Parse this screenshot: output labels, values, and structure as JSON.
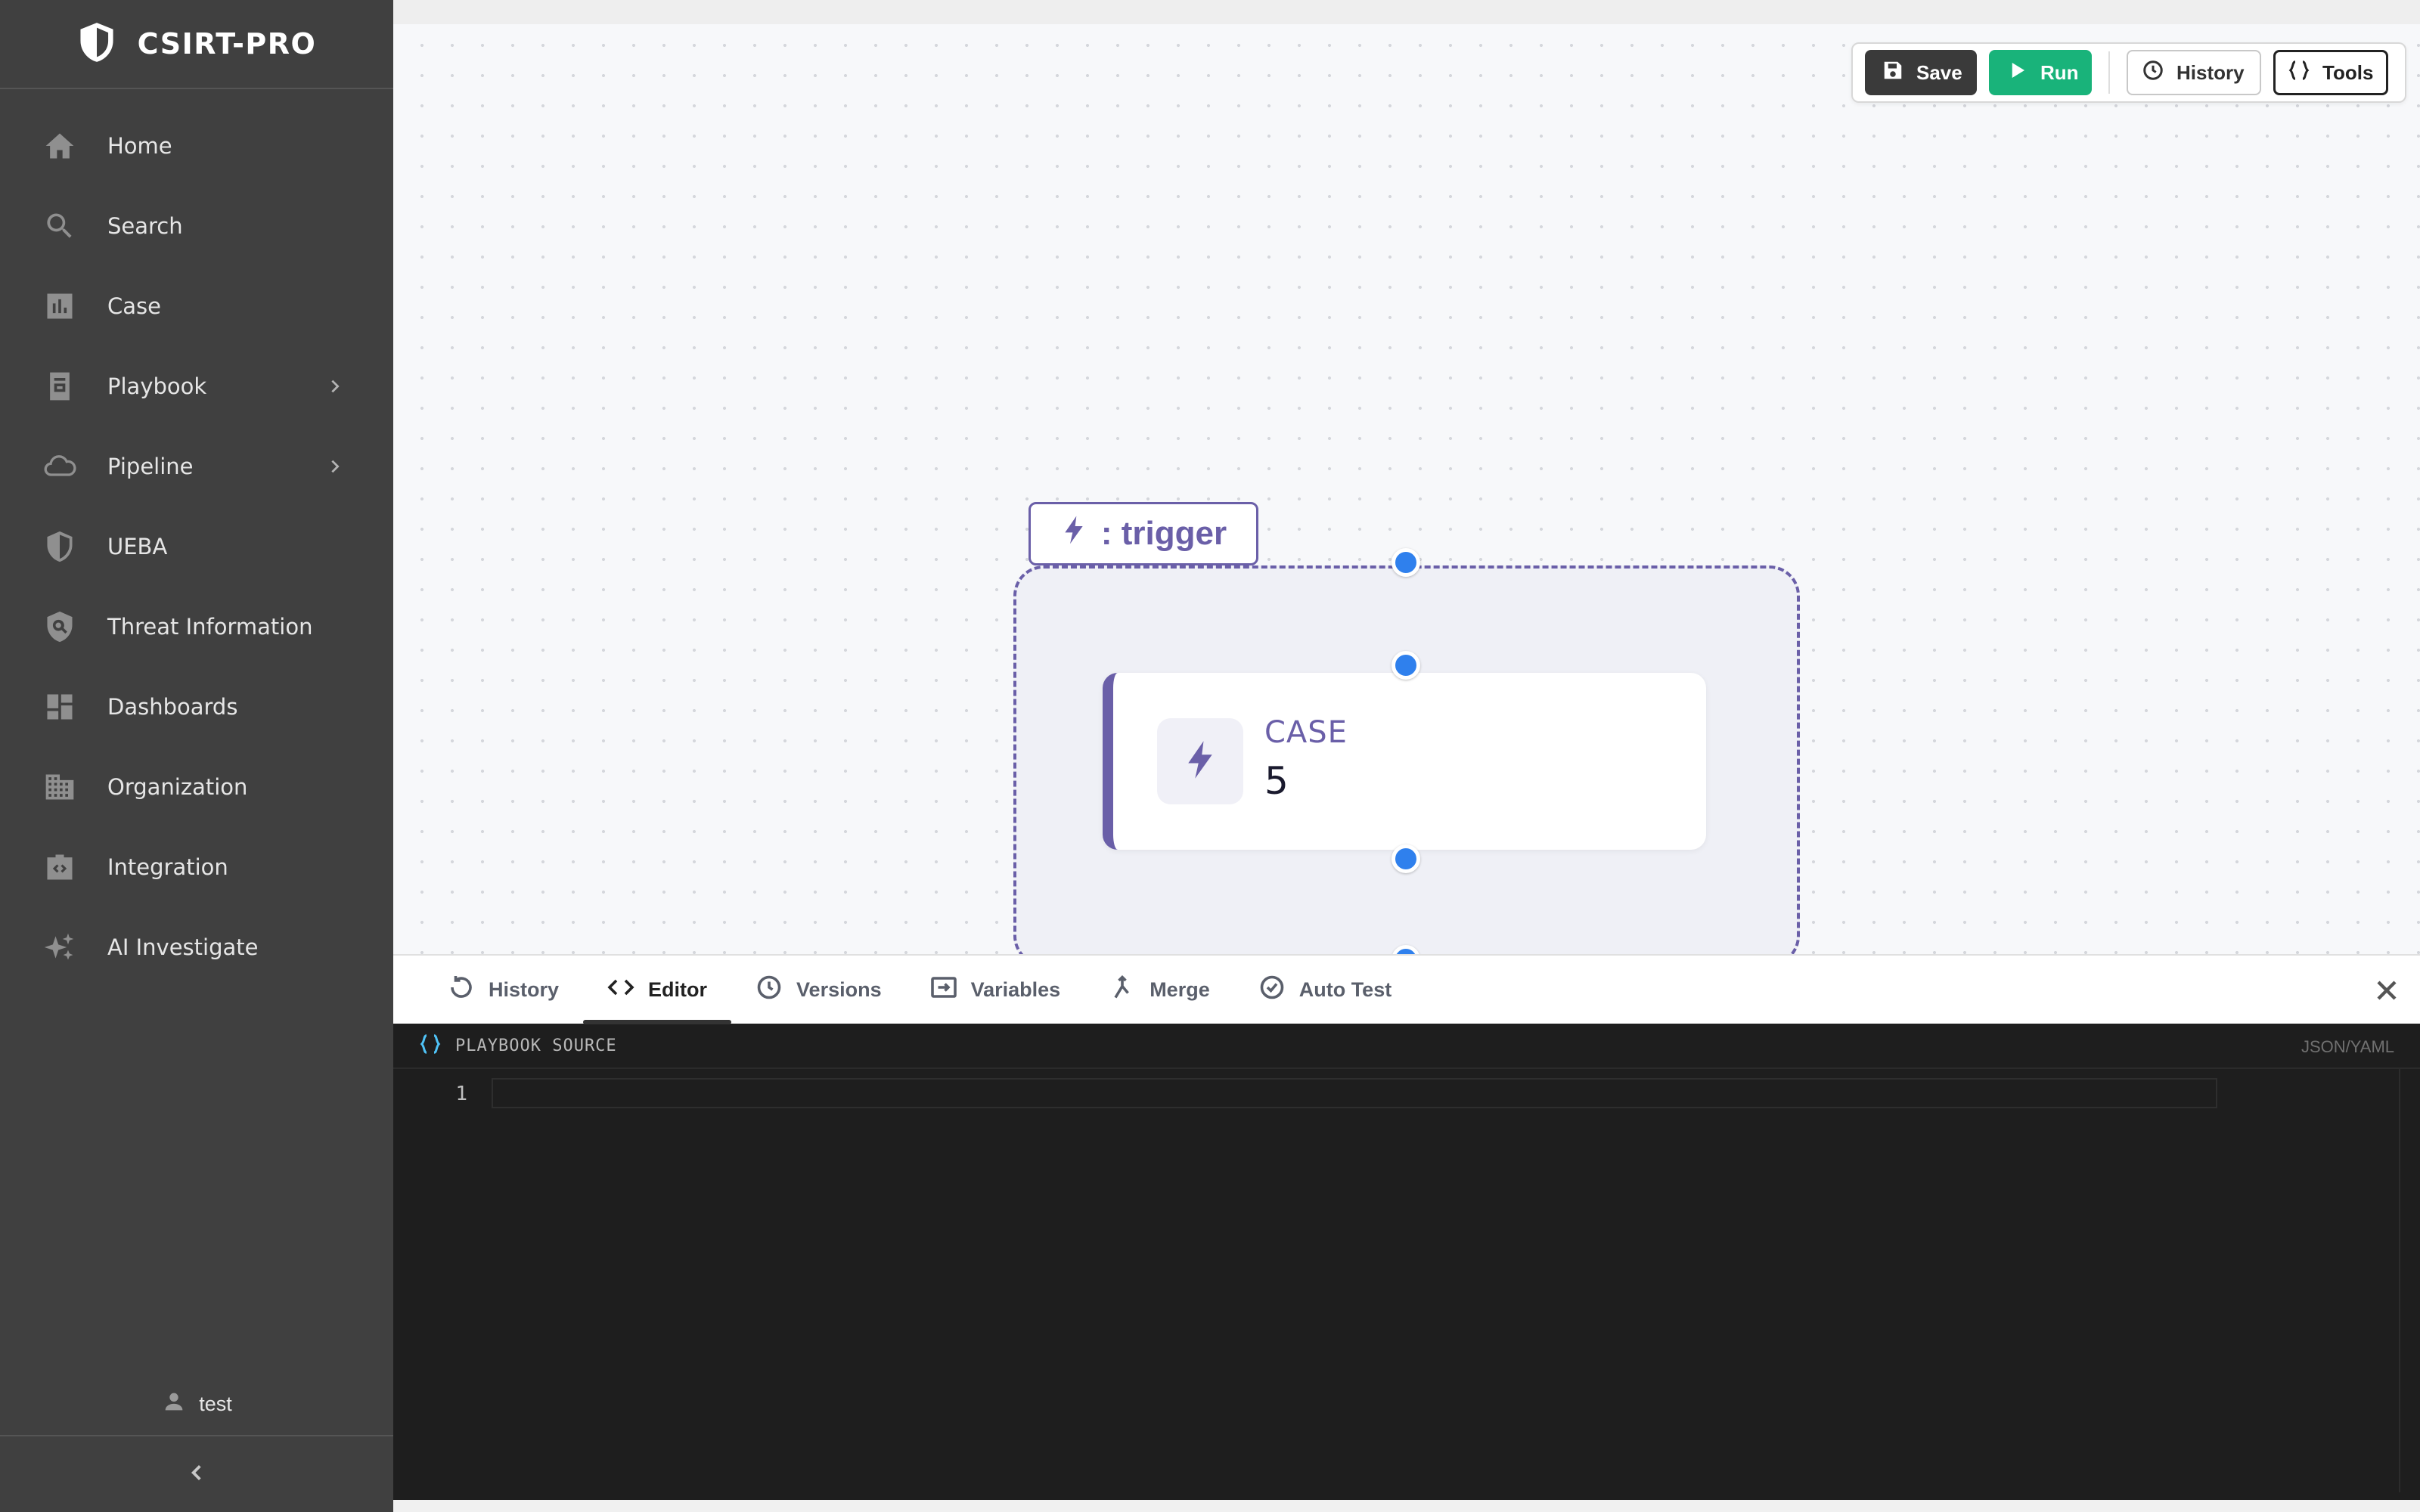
{
  "brand": {
    "title": "CSIRT-PRO"
  },
  "sidebar": {
    "items": [
      {
        "label": "Home",
        "icon": "home-icon"
      },
      {
        "label": "Search",
        "icon": "search-icon"
      },
      {
        "label": "Case",
        "icon": "bar-chart-icon"
      },
      {
        "label": "Playbook",
        "icon": "book-icon",
        "expandable": true
      },
      {
        "label": "Pipeline",
        "icon": "cloud-icon",
        "expandable": true
      },
      {
        "label": "UEBA",
        "icon": "shield-icon"
      },
      {
        "label": "Threat Information",
        "icon": "shield-search-icon"
      },
      {
        "label": "Dashboards",
        "icon": "dashboard-icon"
      },
      {
        "label": "Organization",
        "icon": "building-icon"
      },
      {
        "label": "Integration",
        "icon": "integration-icon"
      },
      {
        "label": "AI Investigate",
        "icon": "sparkle-icon"
      }
    ],
    "user": "test"
  },
  "toolbar": {
    "save_label": "Save",
    "run_label": "Run",
    "history_label": "History",
    "tools_label": "Tools"
  },
  "canvas": {
    "group_label": ": trigger",
    "node": {
      "type": "CASE",
      "value": "5"
    }
  },
  "panel": {
    "tabs": [
      {
        "label": "History",
        "icon": "history-icon"
      },
      {
        "label": "Editor",
        "icon": "code-icon",
        "active": true
      },
      {
        "label": "Versions",
        "icon": "clock-icon"
      },
      {
        "label": "Variables",
        "icon": "variables-icon"
      },
      {
        "label": "Merge",
        "icon": "merge-icon"
      },
      {
        "label": "Auto Test",
        "icon": "check-circle-icon"
      }
    ],
    "source_title": "PLAYBOOK SOURCE",
    "source_format": "JSON/YAML",
    "line_numbers": [
      "1"
    ]
  },
  "colors": {
    "sidebar_bg": "#404040",
    "accent_purple": "#6a5fa8",
    "run_green": "#19b37a",
    "handle_blue": "#2f80ed",
    "editor_bg": "#1e1e1e"
  }
}
